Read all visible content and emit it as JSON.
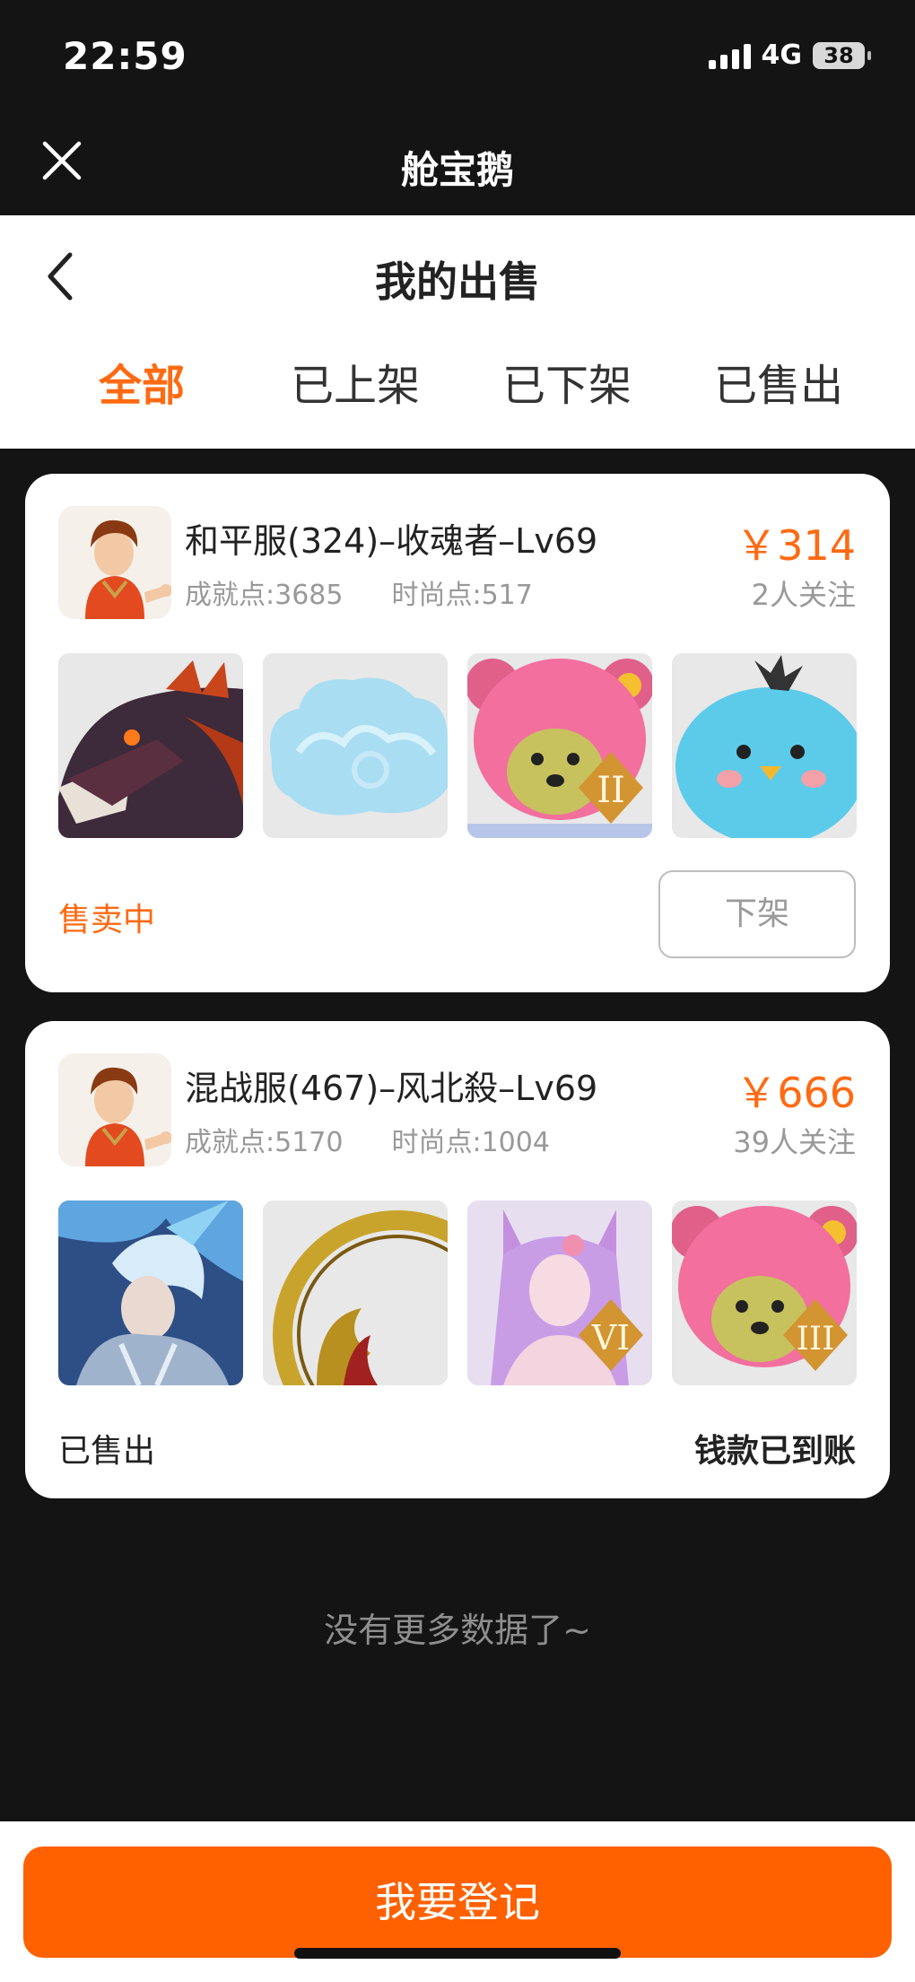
{
  "status_bar": {
    "time": "22:59",
    "network": "4G",
    "battery": "38"
  },
  "app_bar": {
    "title": "舱宝鹅"
  },
  "page": {
    "title": "我的出售"
  },
  "tabs": [
    {
      "label": "全部",
      "active": true
    },
    {
      "label": "已上架",
      "active": false
    },
    {
      "label": "已下架",
      "active": false
    },
    {
      "label": "已售出",
      "active": false
    }
  ],
  "listings": [
    {
      "title": "和平服(324)–收魂者–Lv69",
      "achievement": "成就点:3685",
      "fashion": "时尚点:517",
      "price": "￥314",
      "followers": "2人关注",
      "items": [
        "dragon-head",
        "cloud",
        "pink-bear-ii",
        "blue-bird"
      ],
      "status": "售卖中",
      "action": "下架"
    },
    {
      "title": "混战服(467)–风北殺–Lv69",
      "achievement": "成就点:5170",
      "fashion": "时尚点:1004",
      "price": "￥666",
      "followers": "39人关注",
      "items": [
        "ice-warrior",
        "golden-ring",
        "fox-girl-vi",
        "pink-bear-iii"
      ],
      "status": "已售出",
      "note": "钱款已到账"
    }
  ],
  "badges": {
    "ii": "II",
    "vi": "VI",
    "iii": "III"
  },
  "footer": {
    "no_more": "没有更多数据了~",
    "register_label": "我要登记"
  },
  "colors": {
    "accent": "#ff6a13",
    "button": "#ff6000",
    "background": "#141414"
  }
}
